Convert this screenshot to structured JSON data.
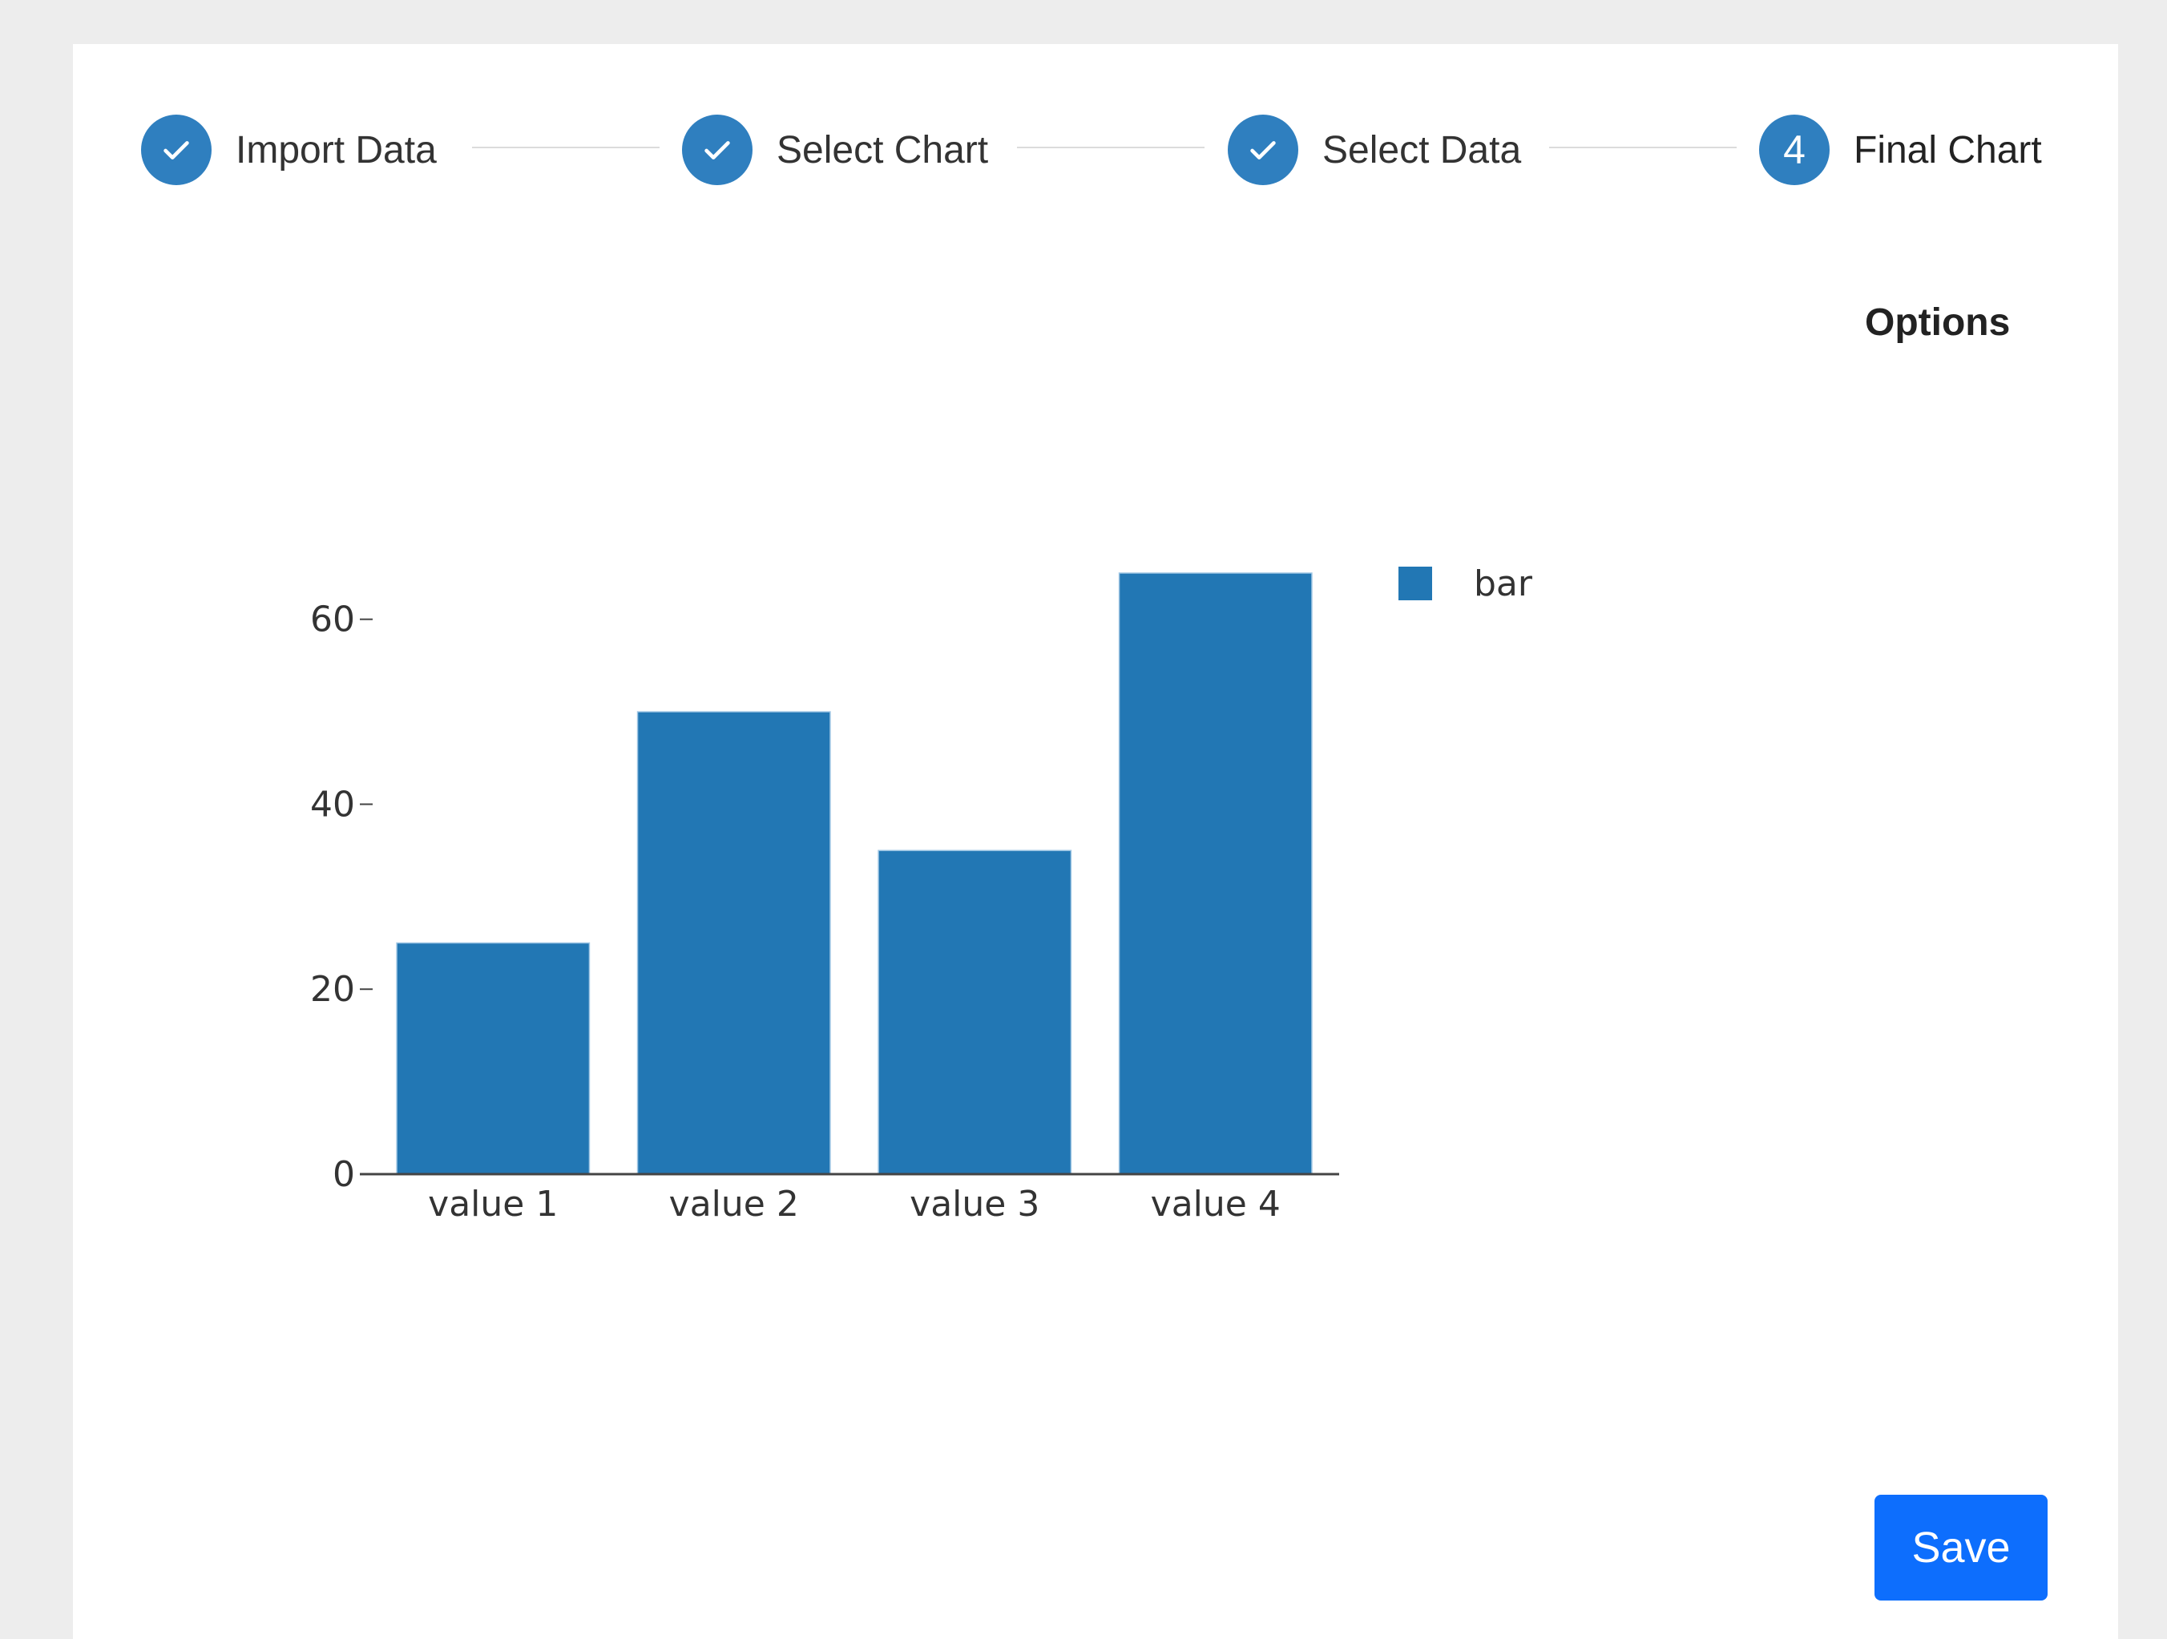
{
  "stepper": {
    "steps": [
      {
        "label": "Import Data",
        "state": "done",
        "icon": "check-icon"
      },
      {
        "label": "Select Chart",
        "state": "done",
        "icon": "check-icon"
      },
      {
        "label": "Select Data",
        "state": "done",
        "icon": "check-icon"
      },
      {
        "label": "Final Chart",
        "state": "active",
        "number": "4"
      }
    ],
    "accent_color": "#2f7fbf"
  },
  "options_label": "Options",
  "save_label": "Save",
  "chart_data": {
    "type": "bar",
    "categories": [
      "value 1",
      "value 2",
      "value 3",
      "value 4"
    ],
    "series": [
      {
        "name": "bar",
        "values": [
          25,
          50,
          35,
          65
        ],
        "color": "#2277b4"
      }
    ],
    "ylim": [
      0,
      65
    ],
    "yticks": [
      0,
      20,
      40,
      60
    ],
    "legend": "right",
    "grid": false
  }
}
